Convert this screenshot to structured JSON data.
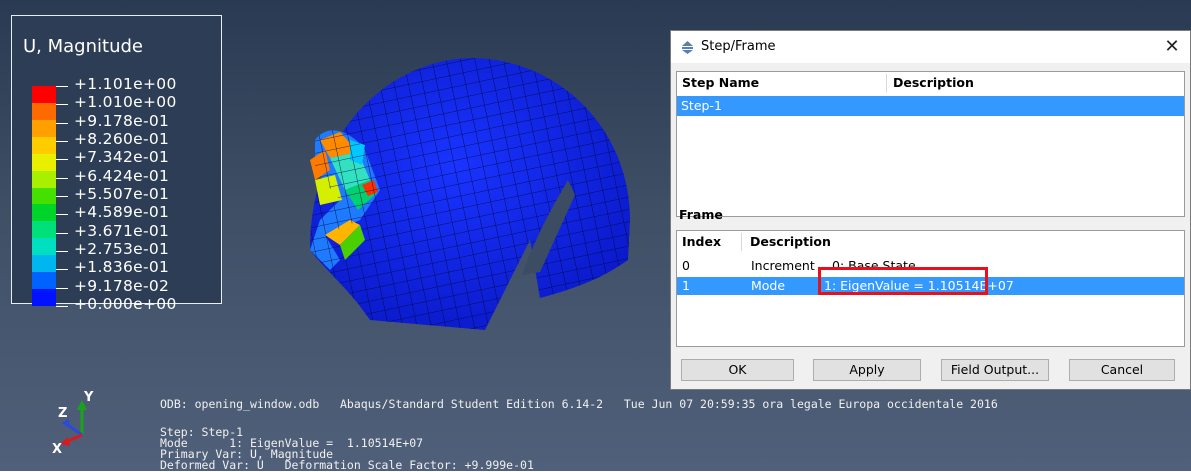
{
  "legend": {
    "title": "U, Magnitude",
    "labels": [
      "+1.101e+00",
      "+1.010e+00",
      "+9.178e-01",
      "+8.260e-01",
      "+7.342e-01",
      "+6.424e-01",
      "+5.507e-01",
      "+4.589e-01",
      "+3.671e-01",
      "+2.753e-01",
      "+1.836e-01",
      "+9.178e-02",
      "+0.000e+00"
    ],
    "colors": [
      "#ff0000",
      "#ff6a00",
      "#ff9f00",
      "#ffcc00",
      "#e8f000",
      "#a8f000",
      "#46e000",
      "#00d428",
      "#00e07a",
      "#00dfc0",
      "#00b6f0",
      "#0062ff",
      "#0012ff"
    ]
  },
  "triad": {
    "y": "Y",
    "z": "Z",
    "x": "X"
  },
  "info": {
    "line1": "ODB: opening_window.odb   Abaqus/Standard Student Edition 6.14-2   Tue Jun 07 20:59:35 ora legale Europa occidentale 2016",
    "line2": "Step: Step-1",
    "line3": "Mode      1: EigenValue =  1.10514E+07",
    "line4": "Primary Var: U, Magnitude",
    "line5": "Deformed Var: U   Deformation Scale Factor: +9.999e-01"
  },
  "dialog": {
    "title": "Step/Frame",
    "close": "✕",
    "step_headers": {
      "name": "Step Name",
      "description": "Description"
    },
    "steps": [
      {
        "name": "Step-1",
        "description": ""
      }
    ],
    "frame_label": "Frame",
    "frame_headers": {
      "index": "Index",
      "description": "Description"
    },
    "frames": [
      {
        "index": "0",
        "type": "Increment",
        "desc": "0: Base State"
      },
      {
        "index": "1",
        "type": "Mode",
        "desc": "1: EigenValue =  1.10514E+07"
      }
    ],
    "buttons": {
      "ok": "OK",
      "apply": "Apply",
      "field_output": "Field Output...",
      "cancel": "Cancel"
    }
  },
  "colors": {
    "selection": "#3399ff",
    "highlight_box": "#e8101a",
    "mesh_blue": "#0a1fd8"
  }
}
